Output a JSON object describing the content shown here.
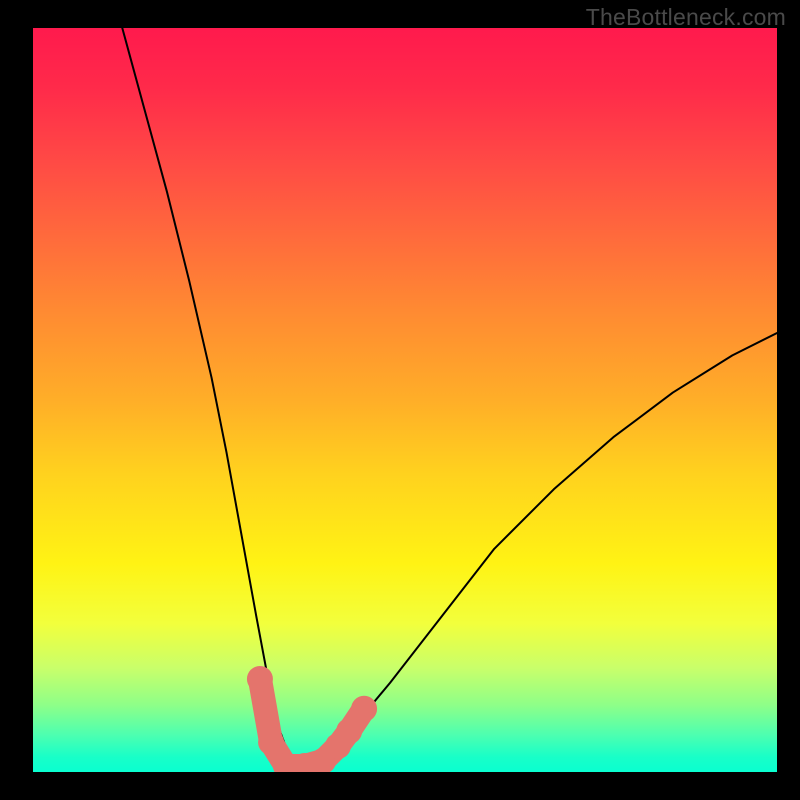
{
  "watermark": "TheBottleneck.com",
  "chart_data": {
    "type": "line",
    "title": "",
    "xlabel": "",
    "ylabel": "",
    "xlim": [
      0,
      100
    ],
    "ylim": [
      0,
      100
    ],
    "series": [
      {
        "name": "bottleneck-curve",
        "x": [
          12,
          15,
          18,
          21,
          24,
          26,
          28,
          30,
          31.5,
          33,
          34.5,
          36,
          38,
          40,
          43,
          48,
          55,
          62,
          70,
          78,
          86,
          94,
          100
        ],
        "values": [
          100,
          89,
          78,
          66,
          53,
          43,
          32,
          21,
          13,
          6,
          2,
          0.5,
          0.5,
          2,
          6,
          12,
          21,
          30,
          38,
          45,
          51,
          56,
          59
        ]
      }
    ],
    "markers": [
      {
        "x": 30.5,
        "y": 12.5
      },
      {
        "x": 32.0,
        "y": 4.0
      },
      {
        "x": 34.0,
        "y": 0.8
      },
      {
        "x": 36.5,
        "y": 0.8
      },
      {
        "x": 39.0,
        "y": 1.5
      },
      {
        "x": 41.0,
        "y": 3.5
      },
      {
        "x": 42.5,
        "y": 5.5
      },
      {
        "x": 44.5,
        "y": 8.5
      }
    ],
    "colors": {
      "curve": "#000000",
      "marker_fill": "#e4746c",
      "marker_stroke": "#e4746c"
    }
  }
}
